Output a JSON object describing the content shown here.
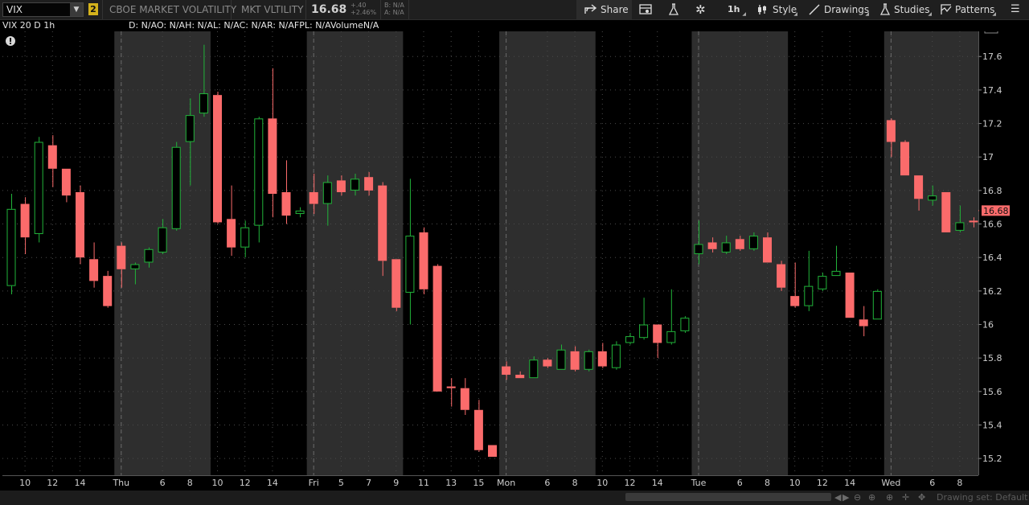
{
  "toolbar": {
    "symbol": "VIX",
    "link_badge": "2",
    "description": "CBOE MARKET VOLATILITY",
    "short_name": "MKT VLTILITY",
    "last_price": "16.68",
    "change_abs": "+.40",
    "change_pct": "+2.46%",
    "bid": "B: N/A",
    "ask": "A: N/A",
    "share_label": "Share",
    "timeframe_label": "1h",
    "style_label": "Style",
    "drawings_label": "Drawings",
    "studies_label": "Studies",
    "patterns_label": "Patterns"
  },
  "infobar": {
    "chart_label": "VIX 20 D 1h",
    "ohlc_text": "D: N/AO: N/AH: N/AL: N/AC: N/AR: N/AFPL: N/AVolumeN/A"
  },
  "footer": {
    "drawing_set": "Drawing set: Default"
  },
  "colors": {
    "up": "#21b43a",
    "down": "#fb6b6b",
    "background": "#000000",
    "alt_session_shade": "#2e2e2e",
    "price_label_bg": "#fb6b6b"
  },
  "chart_data": {
    "type": "candlestick",
    "ylim": [
      15.1,
      17.75
    ],
    "y_ticks": [
      15.2,
      15.4,
      15.6,
      15.8,
      16,
      16.2,
      16.4,
      16.6,
      16.8,
      17,
      17.2,
      17.4,
      17.6
    ],
    "last_price": 16.68,
    "x_ticks": [
      {
        "label": "10",
        "i": 1
      },
      {
        "label": "12",
        "i": 3
      },
      {
        "label": "14",
        "i": 5
      },
      {
        "label": "Thu",
        "i": 8
      },
      {
        "label": "6",
        "i": 11
      },
      {
        "label": "8",
        "i": 13
      },
      {
        "label": "10",
        "i": 15
      },
      {
        "label": "12",
        "i": 17
      },
      {
        "label": "14",
        "i": 19
      },
      {
        "label": "Fri",
        "i": 22
      },
      {
        "label": "5",
        "i": 24
      },
      {
        "label": "7",
        "i": 26
      },
      {
        "label": "9",
        "i": 28
      },
      {
        "label": "11",
        "i": 30
      },
      {
        "label": "13",
        "i": 32
      },
      {
        "label": "15",
        "i": 34
      },
      {
        "label": "Mon",
        "i": 36
      },
      {
        "label": "6",
        "i": 39
      },
      {
        "label": "8",
        "i": 41
      },
      {
        "label": "10",
        "i": 43
      },
      {
        "label": "12",
        "i": 45
      },
      {
        "label": "14",
        "i": 47
      },
      {
        "label": "Tue",
        "i": 50
      },
      {
        "label": "6",
        "i": 53
      },
      {
        "label": "8",
        "i": 55
      },
      {
        "label": "10",
        "i": 57
      },
      {
        "label": "12",
        "i": 59
      },
      {
        "label": "14",
        "i": 61
      },
      {
        "label": "Wed",
        "i": 64
      },
      {
        "label": "6",
        "i": 67
      },
      {
        "label": "8",
        "i": 69
      }
    ],
    "shaded_bars": [
      [
        7,
        14
      ],
      [
        21,
        28
      ],
      [
        35,
        42
      ],
      [
        49,
        56
      ],
      [
        63,
        70
      ]
    ],
    "day_dividers": [
      8,
      22,
      36,
      50,
      64
    ],
    "candles": [
      {
        "o": 16.23,
        "h": 16.78,
        "l": 16.18,
        "c": 16.69
      },
      {
        "o": 16.72,
        "h": 16.76,
        "l": 16.42,
        "c": 16.52
      },
      {
        "o": 16.54,
        "h": 17.12,
        "l": 16.49,
        "c": 17.09
      },
      {
        "o": 17.07,
        "h": 17.13,
        "l": 16.82,
        "c": 16.93
      },
      {
        "o": 16.93,
        "h": 16.93,
        "l": 16.73,
        "c": 16.77
      },
      {
        "o": 16.79,
        "h": 16.83,
        "l": 16.36,
        "c": 16.4
      },
      {
        "o": 16.39,
        "h": 16.49,
        "l": 16.22,
        "c": 16.26
      },
      {
        "o": 16.29,
        "h": 16.32,
        "l": 16.1,
        "c": 16.11
      },
      {
        "o": 16.47,
        "h": 16.49,
        "l": 16.22,
        "c": 16.33
      },
      {
        "o": 16.33,
        "h": 16.37,
        "l": 16.24,
        "c": 16.36
      },
      {
        "o": 16.37,
        "h": 16.46,
        "l": 16.34,
        "c": 16.45
      },
      {
        "o": 16.43,
        "h": 16.63,
        "l": 16.42,
        "c": 16.58
      },
      {
        "o": 16.57,
        "h": 17.09,
        "l": 16.56,
        "c": 17.06
      },
      {
        "o": 17.09,
        "h": 17.35,
        "l": 16.83,
        "c": 17.25
      },
      {
        "o": 17.26,
        "h": 17.67,
        "l": 17.24,
        "c": 17.38
      },
      {
        "o": 17.37,
        "h": 17.39,
        "l": 16.6,
        "c": 16.61
      },
      {
        "o": 16.63,
        "h": 16.83,
        "l": 16.41,
        "c": 16.46
      },
      {
        "o": 16.46,
        "h": 16.62,
        "l": 16.4,
        "c": 16.58
      },
      {
        "o": 16.59,
        "h": 17.24,
        "l": 16.49,
        "c": 17.23
      },
      {
        "o": 17.23,
        "h": 17.53,
        "l": 16.64,
        "c": 16.78
      },
      {
        "o": 16.79,
        "h": 16.98,
        "l": 16.6,
        "c": 16.65
      },
      {
        "o": 16.66,
        "h": 16.7,
        "l": 16.64,
        "c": 16.68
      },
      {
        "o": 16.79,
        "h": 16.9,
        "l": 16.66,
        "c": 16.72
      },
      {
        "o": 16.72,
        "h": 16.89,
        "l": 16.59,
        "c": 16.85
      },
      {
        "o": 16.86,
        "h": 16.89,
        "l": 16.77,
        "c": 16.79
      },
      {
        "o": 16.8,
        "h": 16.9,
        "l": 16.77,
        "c": 16.87
      },
      {
        "o": 16.88,
        "h": 16.91,
        "l": 16.77,
        "c": 16.8
      },
      {
        "o": 16.83,
        "h": 16.85,
        "l": 16.29,
        "c": 16.38
      },
      {
        "o": 16.39,
        "h": 16.39,
        "l": 16.08,
        "c": 16.1
      },
      {
        "o": 16.19,
        "h": 16.87,
        "l": 16.0,
        "c": 16.53
      },
      {
        "o": 16.55,
        "h": 16.58,
        "l": 16.18,
        "c": 16.21
      },
      {
        "o": 16.35,
        "h": 16.36,
        "l": 15.6,
        "c": 15.6
      },
      {
        "o": 15.63,
        "h": 15.68,
        "l": 15.51,
        "c": 15.62
      },
      {
        "o": 15.62,
        "h": 15.68,
        "l": 15.46,
        "c": 15.49
      },
      {
        "o": 15.49,
        "h": 15.55,
        "l": 15.24,
        "c": 15.25
      },
      {
        "o": 15.28,
        "h": 15.28,
        "l": 15.21,
        "c": 15.21
      },
      {
        "o": 15.75,
        "h": 15.78,
        "l": 15.67,
        "c": 15.7
      },
      {
        "o": 15.7,
        "h": 15.72,
        "l": 15.68,
        "c": 15.68
      },
      {
        "o": 15.68,
        "h": 15.81,
        "l": 15.68,
        "c": 15.79
      },
      {
        "o": 15.79,
        "h": 15.8,
        "l": 15.74,
        "c": 15.75
      },
      {
        "o": 15.73,
        "h": 15.88,
        "l": 15.73,
        "c": 15.85
      },
      {
        "o": 15.84,
        "h": 15.87,
        "l": 15.72,
        "c": 15.73
      },
      {
        "o": 15.73,
        "h": 15.85,
        "l": 15.72,
        "c": 15.84
      },
      {
        "o": 15.84,
        "h": 15.89,
        "l": 15.74,
        "c": 15.75
      },
      {
        "o": 15.74,
        "h": 15.9,
        "l": 15.73,
        "c": 15.88
      },
      {
        "o": 15.89,
        "h": 15.95,
        "l": 15.88,
        "c": 15.93
      },
      {
        "o": 15.92,
        "h": 16.16,
        "l": 15.91,
        "c": 16.0
      },
      {
        "o": 16.0,
        "h": 16.0,
        "l": 15.8,
        "c": 15.89
      },
      {
        "o": 15.89,
        "h": 16.21,
        "l": 15.88,
        "c": 15.96
      },
      {
        "o": 15.96,
        "h": 16.05,
        "l": 15.95,
        "c": 16.04
      },
      {
        "o": 16.42,
        "h": 16.62,
        "l": 16.36,
        "c": 16.48
      },
      {
        "o": 16.49,
        "h": 16.52,
        "l": 16.43,
        "c": 16.45
      },
      {
        "o": 16.43,
        "h": 16.53,
        "l": 16.42,
        "c": 16.49
      },
      {
        "o": 16.51,
        "h": 16.53,
        "l": 16.44,
        "c": 16.45
      },
      {
        "o": 16.45,
        "h": 16.55,
        "l": 16.44,
        "c": 16.53
      },
      {
        "o": 16.52,
        "h": 16.55,
        "l": 16.37,
        "c": 16.37
      },
      {
        "o": 16.36,
        "h": 16.38,
        "l": 16.2,
        "c": 16.22
      },
      {
        "o": 16.17,
        "h": 16.37,
        "l": 16.1,
        "c": 16.11
      },
      {
        "o": 16.11,
        "h": 16.44,
        "l": 16.08,
        "c": 16.23
      },
      {
        "o": 16.21,
        "h": 16.31,
        "l": 16.2,
        "c": 16.29
      },
      {
        "o": 16.29,
        "h": 16.47,
        "l": 16.29,
        "c": 16.32
      },
      {
        "o": 16.31,
        "h": 16.31,
        "l": 16.04,
        "c": 16.04
      },
      {
        "o": 16.03,
        "h": 16.11,
        "l": 15.93,
        "c": 15.99
      },
      {
        "o": 16.03,
        "h": 16.21,
        "l": 16.03,
        "c": 16.2
      },
      {
        "o": 17.22,
        "h": 17.23,
        "l": 17.0,
        "c": 17.09
      },
      {
        "o": 17.09,
        "h": 17.1,
        "l": 16.89,
        "c": 16.89
      },
      {
        "o": 16.89,
        "h": 16.89,
        "l": 16.68,
        "c": 16.75
      },
      {
        "o": 16.74,
        "h": 16.83,
        "l": 16.71,
        "c": 16.77
      },
      {
        "o": 16.79,
        "h": 16.79,
        "l": 16.55,
        "c": 16.55
      },
      {
        "o": 16.56,
        "h": 16.71,
        "l": 16.55,
        "c": 16.61
      },
      {
        "o": 16.62,
        "h": 16.64,
        "l": 16.58,
        "c": 16.61
      }
    ]
  }
}
